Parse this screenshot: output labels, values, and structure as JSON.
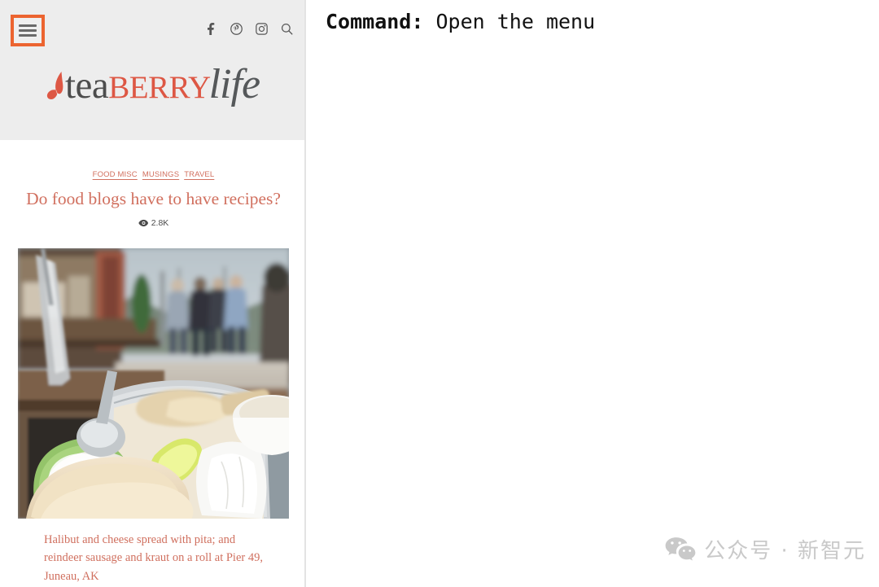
{
  "mobile_site": {
    "header": {
      "menu_button": {
        "icon": "hamburger-menu-icon",
        "label": "Menu",
        "highlight_color": "#ec6430"
      },
      "icons": [
        {
          "name": "facebook-icon",
          "label": "Facebook"
        },
        {
          "name": "pinterest-icon",
          "label": "Pinterest"
        },
        {
          "name": "instagram-icon",
          "label": "Instagram"
        },
        {
          "name": "search-icon",
          "label": "Search"
        }
      ],
      "logo": {
        "part1": "tea",
        "part2": "BERRY",
        "part3": "life",
        "leaf_icon": "tea-leaf-icon",
        "color_part1": "#4d4d4d",
        "color_part2": "#dd5744",
        "color_part3": "#55585a"
      },
      "background_color": "#ededed"
    },
    "post": {
      "categories": [
        "FOOD MISC",
        "MUSINGS",
        "TRAVEL"
      ],
      "title": "Do food blogs have to have recipes?",
      "views": {
        "icon": "eye-icon",
        "count": "2.8K"
      },
      "photo_alt": "Basket of halibut and cheese spread with pita on an outdoor waterfront patio",
      "caption": "Halibut and cheese spread with pita; and reindeer sausage and kraut on a roll at Pier 49, Juneau, AK",
      "accent_color": "#d1705f"
    }
  },
  "command_panel": {
    "label": "Command:",
    "text": "Open the menu"
  },
  "watermark": {
    "icon": "wechat-icon",
    "text": "公众号 · 新智元"
  }
}
